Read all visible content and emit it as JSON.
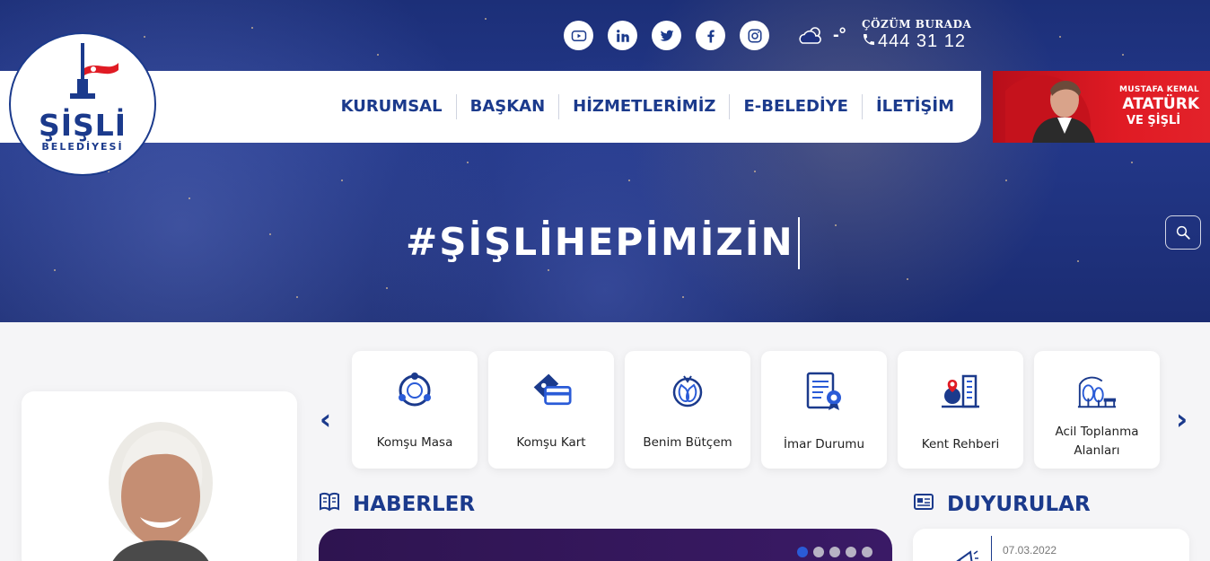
{
  "site": {
    "logo_name": "ŞİŞLİ",
    "logo_sub": "BELEDİYESİ"
  },
  "social": [
    "youtube-icon",
    "linkedin-icon",
    "twitter-icon",
    "facebook-icon",
    "instagram-icon"
  ],
  "weather": {
    "value": "-°"
  },
  "hotline": {
    "label": "ÇÖZÜM BURADA",
    "number": "444 31 12"
  },
  "nav": {
    "items": [
      "KURUMSAL",
      "BAŞKAN",
      "HİZMETLERİMİZ",
      "E-BELEDİYE",
      "İLETİŞİM"
    ]
  },
  "banner": {
    "line1": "MUSTAFA KEMAL",
    "line2": "ATATÜRK",
    "line3": "VE ŞİŞLİ"
  },
  "hero": {
    "hashtag": "#ŞİŞLİHEPİMİZİN"
  },
  "services": {
    "prev": "‹",
    "next": "›",
    "items": [
      {
        "label": "Komşu Masa",
        "icon": "komsu-masa-icon"
      },
      {
        "label": "Komşu Kart",
        "icon": "komsu-kart-icon"
      },
      {
        "label": "Benim Bütçem",
        "icon": "budget-icon"
      },
      {
        "label": "İmar Durumu",
        "icon": "zoning-document-icon"
      },
      {
        "label": "Kent Rehberi",
        "icon": "city-guide-icon"
      },
      {
        "label": "Acil Toplanma Alanları",
        "label_line1": "Acil Toplanma",
        "label_line2": "Alanları",
        "icon": "assembly-area-icon"
      }
    ]
  },
  "sections": {
    "news_title": "HABERLER",
    "announcements_title": "DUYURULAR"
  },
  "announcements": [
    {
      "date": "07.03.2022"
    }
  ],
  "colors": {
    "brand": "#1b3a8c",
    "accent_red": "#e01b24",
    "news_bg": "#3a1a66",
    "dot_active": "#2a5bd7"
  }
}
